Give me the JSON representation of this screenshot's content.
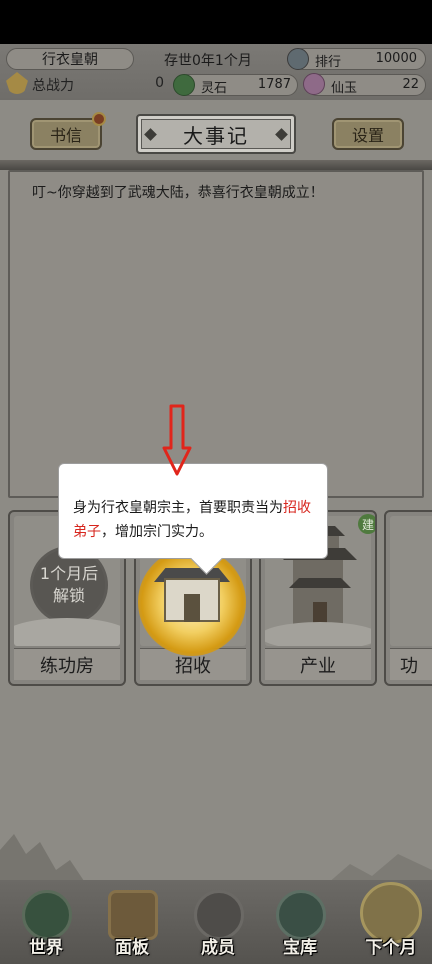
{
  "header": {
    "sect_name": "行衣皇朝",
    "age": "存世0年1个月",
    "rank_label": "排行",
    "rank_value": "10000",
    "power_label": "总战力",
    "power_value": "0",
    "stone_label": "灵石",
    "stone_value": "1787",
    "jade_label": "仙玉",
    "jade_value": "22"
  },
  "title_bar": {
    "letters": "书信",
    "title": "大事记",
    "settings": "设置"
  },
  "log": {
    "lines": [
      "叮~你穿越到了武魂大陆，恭喜行衣皇朝成立！"
    ]
  },
  "tooltip": {
    "text_before": "身为行衣皇朝宗主，首要职责当为",
    "highlight": "招收弟子",
    "text_after": "，增加宗门实力。"
  },
  "buildings": [
    {
      "label": "练功房",
      "lock_text_1": "1个月后",
      "lock_text_2": "解锁"
    },
    {
      "label": "招收"
    },
    {
      "label": "产业",
      "badge": "建"
    },
    {
      "label": "功"
    }
  ],
  "nav": {
    "world": "世界",
    "panel": "面板",
    "members": "成员",
    "vault": "宝库",
    "next_month": "下个月"
  },
  "colors": {
    "highlight_text": "#d7261e",
    "guide_arrow": "#e1251b",
    "recruit_glow": "#f2c94c"
  }
}
